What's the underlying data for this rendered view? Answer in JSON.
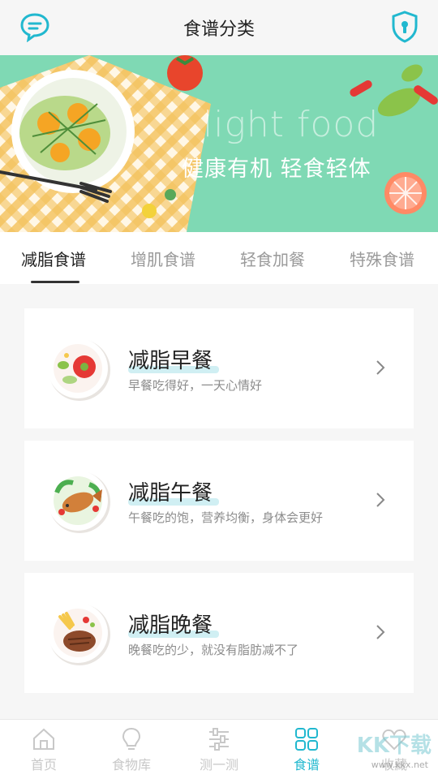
{
  "header": {
    "title": "食谱分类",
    "left_icon": "chat-bubble-icon",
    "right_icon": "shield-lock-icon",
    "accent": "#21b8cf"
  },
  "banner": {
    "en_text": "light food",
    "cn_text": "健康有机 轻食轻体",
    "bg_color": "#7fd9b4"
  },
  "tabs": [
    {
      "label": "减脂食谱",
      "active": true
    },
    {
      "label": "增肌食谱",
      "active": false
    },
    {
      "label": "轻食加餐",
      "active": false
    },
    {
      "label": "特殊食谱",
      "active": false
    }
  ],
  "cards": [
    {
      "name": "减脂早餐",
      "desc": "早餐吃得好，一天心情好",
      "icon": "breakfast-plate-icon"
    },
    {
      "name": "减脂午餐",
      "desc": "午餐吃的饱，营养均衡，身体会更好",
      "icon": "fish-plate-icon"
    },
    {
      "name": "减脂晚餐",
      "desc": "晚餐吃的少，就没有脂肪减不了",
      "icon": "steak-plate-icon"
    }
  ],
  "bottom_nav": [
    {
      "label": "首页",
      "icon": "home-icon",
      "active": false
    },
    {
      "label": "食物库",
      "icon": "lightbulb-icon",
      "active": false
    },
    {
      "label": "测一测",
      "icon": "sliders-icon",
      "active": false
    },
    {
      "label": "食谱",
      "icon": "grid-icon",
      "active": true
    },
    {
      "label": "收藏",
      "icon": "heart-icon",
      "active": false
    }
  ],
  "watermark": {
    "text": "KK下载",
    "url": "www.kkx.net"
  }
}
